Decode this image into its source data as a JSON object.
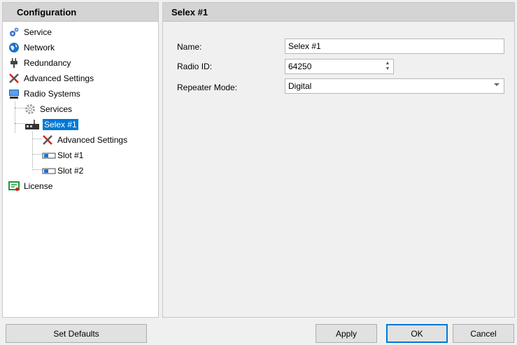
{
  "left_panel": {
    "title": "Configuration",
    "tree": [
      {
        "label": "Service",
        "icon": "gear-cog-icon"
      },
      {
        "label": "Network",
        "icon": "globe-icon"
      },
      {
        "label": "Redundancy",
        "icon": "plug-icon"
      },
      {
        "label": "Advanced Settings",
        "icon": "tools-icon"
      },
      {
        "label": "Radio Systems",
        "icon": "computer-icon"
      },
      {
        "label": "Services",
        "icon": "gear-icon"
      },
      {
        "label": "Selex #1",
        "icon": "radio-icon"
      },
      {
        "label": "Advanced Settings",
        "icon": "tools-icon"
      },
      {
        "label": "Slot #1",
        "icon": "slot-icon"
      },
      {
        "label": "Slot #2",
        "icon": "slot-icon"
      },
      {
        "label": "License",
        "icon": "license-icon"
      }
    ]
  },
  "right_panel": {
    "title": "Selex #1",
    "name_label": "Name:",
    "name_value": "Selex #1",
    "radio_id_label": "Radio ID:",
    "radio_id_value": "64250",
    "repeater_mode_label": "Repeater Mode:",
    "repeater_mode_value": "Digital"
  },
  "buttons": {
    "set_defaults": "Set Defaults",
    "apply": "Apply",
    "ok": "OK",
    "cancel": "Cancel"
  },
  "colors": {
    "selection": "#0078d7",
    "header_bg": "#d4d4d4"
  }
}
